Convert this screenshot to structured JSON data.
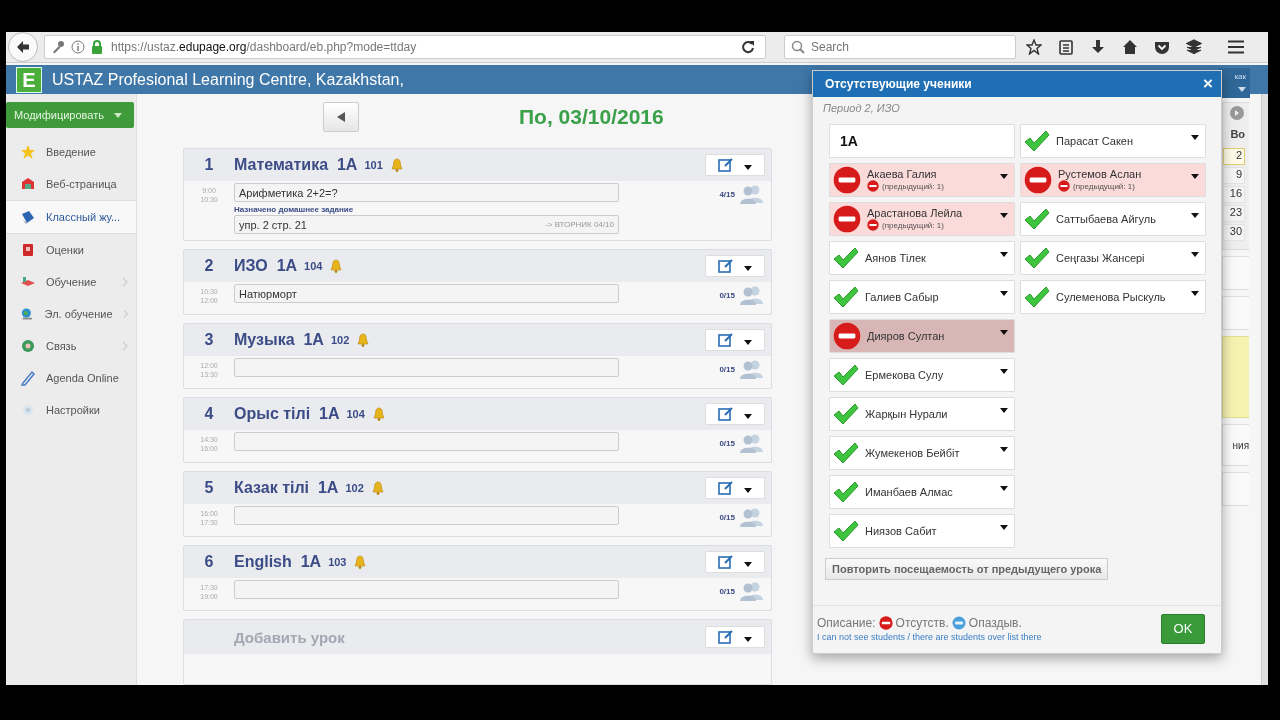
{
  "browser": {
    "url": {
      "prefix": "https://ustaz.",
      "domain": "edupage.org",
      "path": "/dashboard/eb.php?mode=ttday"
    },
    "search": {
      "placeholder": "Search"
    }
  },
  "header": {
    "logo_letter": "E",
    "title": "USTAZ Profesional Learning Centre, Kazakhstan,",
    "user_partial": "как"
  },
  "sidebar": {
    "action_button": "Модифицировать",
    "items": [
      {
        "label": "Введение",
        "kind": "star",
        "submenu": false,
        "selected": false
      },
      {
        "label": "Веб-страница",
        "kind": "web",
        "submenu": false,
        "selected": false
      },
      {
        "label": "Классный жу...",
        "kind": "journal",
        "submenu": false,
        "selected": true
      },
      {
        "label": "Оценки",
        "kind": "grades",
        "submenu": false,
        "selected": false
      },
      {
        "label": "Обучение",
        "kind": "study",
        "submenu": true,
        "selected": false
      },
      {
        "label": "Эл. обучение",
        "kind": "globe",
        "submenu": true,
        "selected": false
      },
      {
        "label": "Связь",
        "kind": "contact",
        "submenu": true,
        "selected": false
      },
      {
        "label": "Agenda Online",
        "kind": "pen",
        "submenu": false,
        "selected": false
      },
      {
        "label": "Настройки",
        "kind": "settings",
        "submenu": false,
        "selected": false
      }
    ]
  },
  "day": {
    "date": "По, 03/10/2016",
    "lessons": [
      {
        "number": "1",
        "subject": "Математика",
        "class": "1А",
        "room": "101",
        "start": "9:00",
        "end": "10:30",
        "topic": "Арифметика 2+2=?",
        "homework_label": "Назначено домашнее задание",
        "homework": "упр. 2 стр. 21",
        "homework_due": "-> ВТОРНИК 04/10",
        "attendance": "4/15"
      },
      {
        "number": "2",
        "subject": "ИЗО",
        "class": "1А",
        "room": "104",
        "start": "10:30",
        "end": "12:00",
        "topic": "Натюрморт",
        "attendance": "0/15"
      },
      {
        "number": "3",
        "subject": "Музыка",
        "class": "1А",
        "room": "102",
        "start": "12:00",
        "end": "13:30",
        "attendance": "0/15"
      },
      {
        "number": "4",
        "subject": "Орыс тілі",
        "class": "1А",
        "room": "104",
        "start": "14:30",
        "end": "16:00",
        "attendance": "0/15"
      },
      {
        "number": "5",
        "subject": "Казак тілі",
        "class": "1А",
        "room": "102",
        "start": "16:00",
        "end": "17:30",
        "attendance": "0/15"
      },
      {
        "number": "6",
        "subject": "English",
        "class": "1А",
        "room": "103",
        "start": "17:30",
        "end": "19:00",
        "attendance": "0/15"
      }
    ],
    "add_lesson": "Добавить урок"
  },
  "calendar_partial": {
    "weekday": "Во",
    "dates": [
      {
        "label": "2",
        "selected": true
      },
      {
        "label": "9",
        "selected": false
      },
      {
        "label": "16",
        "selected": false
      },
      {
        "label": "23",
        "selected": false
      },
      {
        "label": "30",
        "selected": false
      }
    ],
    "text": "ния"
  },
  "dialog": {
    "title": "Отсутствующие ученики",
    "close": "×",
    "subtitle": "Период 2, ИЗО",
    "class_label": "1А",
    "students": [
      {
        "name": "Акаева Галия",
        "absent": true,
        "previous": "(предыдущий: 1)",
        "highlighted": false
      },
      {
        "name": "Арастанова Лейла",
        "absent": true,
        "previous": "(предыдущий: 1)",
        "highlighted": false
      },
      {
        "name": "Аянов Тілек",
        "absent": false,
        "highlighted": false
      },
      {
        "name": "Галиев Сабыр",
        "absent": false,
        "highlighted": false
      },
      {
        "name": "Дияров Султан",
        "absent": true,
        "highlighted": true
      },
      {
        "name": "Ермекова Сулу",
        "absent": false,
        "highlighted": false
      },
      {
        "name": "Жарқын Нурали",
        "absent": false,
        "highlighted": false
      },
      {
        "name": "Жумекенов Бейбіт",
        "absent": false,
        "highlighted": false
      },
      {
        "name": "Иманбаев Алмас",
        "absent": false,
        "highlighted": false
      },
      {
        "name": "Ниязов Сабит",
        "absent": false,
        "highlighted": false
      },
      {
        "name": "Парасат Сакен",
        "absent": false,
        "highlighted": false
      },
      {
        "name": "Рустемов Аслан",
        "absent": true,
        "previous": "(предыдущий: 1)",
        "highlighted": false
      },
      {
        "name": "Саттыбаева Айгуль",
        "absent": false,
        "highlighted": false
      },
      {
        "name": "Сеңгазы Жансері",
        "absent": false,
        "highlighted": false
      },
      {
        "name": "Сулеменова Рыскуль",
        "absent": false,
        "highlighted": false
      }
    ],
    "repeat_button": "Повторить посещаемость от предыдущего урока",
    "legend": {
      "label": "Описание:",
      "absent": "Отсутств.",
      "late": "Опаздыв."
    },
    "help_link": "I can not see students / there are students over list there",
    "ok_button": "OK"
  }
}
